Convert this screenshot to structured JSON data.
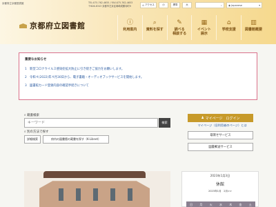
{
  "header": {
    "site_subtitle": "京都府立京都図書館",
    "contact_lines": [
      "TEL:075-762-4655 / FAX:075-762-4653",
      "〒606-8343 京都市左京区岡崎成勝寺町9"
    ],
    "logo_text": "京都府立図書館",
    "util": {
      "access": "アクセス",
      "size_small": "小",
      "size_std": "標準",
      "size_large": "大"
    },
    "language": "Japanese",
    "nav": [
      {
        "label": "利用案内",
        "icon": "info-icon"
      },
      {
        "label": "資料を探す",
        "icon": "search-icon"
      },
      {
        "label": "調べる\n相談する",
        "icon": "pencil-icon"
      },
      {
        "label": "イベント\n展示",
        "icon": "calendar-icon"
      },
      {
        "label": "学校支援",
        "icon": "school-icon"
      },
      {
        "label": "図書館概要",
        "icon": "library-icon"
      }
    ]
  },
  "notice": {
    "title": "重要なお知らせ",
    "items": [
      "1　新型コロナウイルス感染症拡大防止に引き続きご協力をお願いします。",
      "2　令和４(2022)年４月30日から、電子書籍・オーディオブックサービスを開始します。",
      "3　図書館カード登録内容の確認手続きについて"
    ]
  },
  "search": {
    "label": "蔵書検索",
    "placeholder": "キーワード",
    "button": "検索",
    "other_label": "別の方法で探す",
    "detail_button": "詳細検索",
    "kl_button": "府内の図書館の蔵書を探す（K-Libnet）"
  },
  "services": {
    "mypage_button": "マイページ　ログイン",
    "mypage_link": "マイページ（旧利用者のページ）とは",
    "items": [
      "取寄せサービス",
      "図書郵送サービス"
    ]
  },
  "calendar": {
    "date": "2023年1月3日",
    "status": "休館",
    "month_nav": "2023年1月　2月>>",
    "weekdays": [
      "日",
      "月",
      "火",
      "水",
      "木",
      "金",
      "土"
    ]
  },
  "colors": {
    "accent": "#c79a2a",
    "notice_border": "#d9708a",
    "link": "#2a5aa0"
  }
}
